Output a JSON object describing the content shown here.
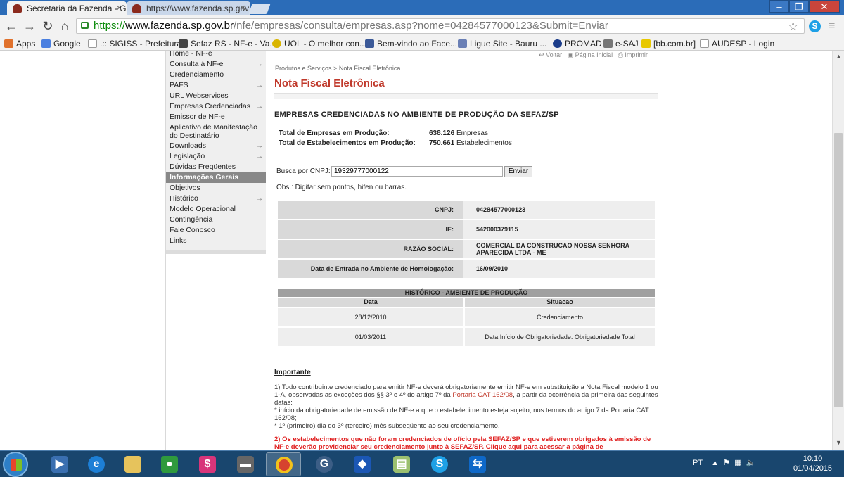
{
  "browser": {
    "tabs": [
      {
        "title": "Secretaria da Fazenda - G",
        "active": true
      },
      {
        "title": "https://www.fazenda.sp.gov",
        "active": false
      }
    ],
    "url": {
      "scheme": "https://",
      "host": "www.fazenda.sp.gov.br",
      "path": "/nfe/empresas/consulta/empresas.asp?nome=04284577000123&Submit=Enviar"
    },
    "bookmarks": [
      {
        "label": "Apps",
        "icon": "apps-grid-icon",
        "color": "#e0712c"
      },
      {
        "label": "Google",
        "icon": "google-icon",
        "color": "#4a7fe0"
      },
      {
        "label": ".:: SIGISS - Prefeitura...",
        "icon": "page-icon",
        "color": "#bbbbbb"
      },
      {
        "label": "Sefaz RS - NF-e - Va...",
        "icon": "sefaz-icon",
        "color": "#444444"
      },
      {
        "label": "UOL - O melhor con...",
        "icon": "uol-icon",
        "color": "#d9b500"
      },
      {
        "label": "Bem-vindo ao Face...",
        "icon": "facebook-icon",
        "color": "#3b5998"
      },
      {
        "label": "Ligue Site - Bauru ...",
        "icon": "ligue-icon",
        "color": "#6a7fb5"
      },
      {
        "label": "PROMAD",
        "icon": "promad-icon",
        "color": "#1b3c8a"
      },
      {
        "label": "e-SAJ",
        "icon": "esaj-icon",
        "color": "#777777"
      },
      {
        "label": "[bb.com.br]",
        "icon": "bb-icon",
        "color": "#e8c800"
      },
      {
        "label": "AUDESP - Login",
        "icon": "page-icon",
        "color": "#bbbbbb"
      }
    ]
  },
  "sidebar": {
    "items": [
      {
        "label": "Home - NF-e",
        "arrow": false
      },
      {
        "label": "Consulta à NF-e",
        "arrow": true
      },
      {
        "label": "Credenciamento",
        "arrow": false
      },
      {
        "label": "PAFS",
        "arrow": true
      },
      {
        "label": "URL Webservices",
        "arrow": false
      },
      {
        "label": "Empresas Credenciadas",
        "arrow": true
      },
      {
        "label": "Emissor de NF-e",
        "arrow": false
      },
      {
        "label": "Aplicativo de Manifestação do Destinatário",
        "arrow": false
      },
      {
        "label": "Downloads",
        "arrow": true
      },
      {
        "label": "Legislação",
        "arrow": true
      },
      {
        "label": "Dúvidas Freqüentes",
        "arrow": false
      },
      {
        "label": "Informações Gerais",
        "arrow": false
      },
      {
        "label": "Objetivos",
        "arrow": false
      },
      {
        "label": "Histórico",
        "arrow": true
      },
      {
        "label": "Modelo Operacional",
        "arrow": false
      },
      {
        "label": "Contingência",
        "arrow": false
      },
      {
        "label": "Fale Conosco",
        "arrow": false
      },
      {
        "label": "Links",
        "arrow": false
      }
    ]
  },
  "toplinks": {
    "voltar": "Voltar",
    "inicial": "Página Inicial",
    "imprimir": "Imprimir"
  },
  "breadcrumb": {
    "root": "Produtos e Serviços",
    "sep": ">",
    "current": "Nota Fiscal Eletrônica"
  },
  "page_title": "Nota Fiscal Eletrônica",
  "heading": "EMPRESAS CREDENCIADAS NO AMBIENTE DE PRODUÇÃO DA SEFAZ/SP",
  "stats": [
    {
      "label": "Total de Empresas em Produção:",
      "value": "638.126",
      "unit": "Empresas"
    },
    {
      "label": "Total de Estabelecimentos em Produção:",
      "value": "750.661",
      "unit": "Estabelecimentos"
    }
  ],
  "search": {
    "label": "Busca por CNPJ:",
    "value": "19329777000122",
    "button": "Enviar",
    "obs": "Obs.: Digitar sem pontos, hifen ou barras."
  },
  "details": [
    {
      "label": "CNPJ:",
      "value": "04284577000123"
    },
    {
      "label": "IE:",
      "value": "542000379115"
    },
    {
      "label": "RAZÃO SOCIAL:",
      "value": "COMERCIAL DA CONSTRUCAO NOSSA SENHORA APARECIDA LTDA - ME"
    },
    {
      "label": "Data de Entrada no Ambiente de Homologação:",
      "value": "16/09/2010"
    }
  ],
  "history": {
    "title": "HISTÓRICO - AMBIENTE DE PRODUÇÃO",
    "columns": [
      "Data",
      "Situacao"
    ],
    "rows": [
      [
        "28/12/2010",
        "Credenciamento"
      ],
      [
        "01/03/2011",
        "Data Início de Obrigatoriedade. Obrigatoriedade Total"
      ]
    ]
  },
  "important": {
    "title": "Importante",
    "p1_a": "1) Todo contribuinte credenciado para emitir NF-e deverá obrigatoriamente emitir NF-e em substituição a Nota Fiscal modelo 1 ou 1-A, observadas as exceções dos §§ 3º e 4º do artigo 7º da ",
    "p1_link": "Portaria CAT 162/08",
    "p1_b": ", a partir da ocorrência da primeira das seguintes datas:",
    "bullet1": "* início da obrigatoriedade de emissão de NF-e a que o estabelecimento esteja sujeito, nos termos do artigo 7 da Portaria CAT 162/08;",
    "bullet2": "* 1º (primeiro) dia do 3º (terceiro) mês subseqüente ao seu credenciamento.",
    "p2": "2) Os estabelecimentos que não foram credenciados de ofício pela SEFAZ/SP e que estiverem obrigados à emissão de NF-e deverão providenciar seu credenciamento junto à SEFAZ/SP. Clique aqui para acessar a página de"
  },
  "taskbar": {
    "lang": "PT",
    "time": "10:10",
    "date": "01/04/2015"
  }
}
